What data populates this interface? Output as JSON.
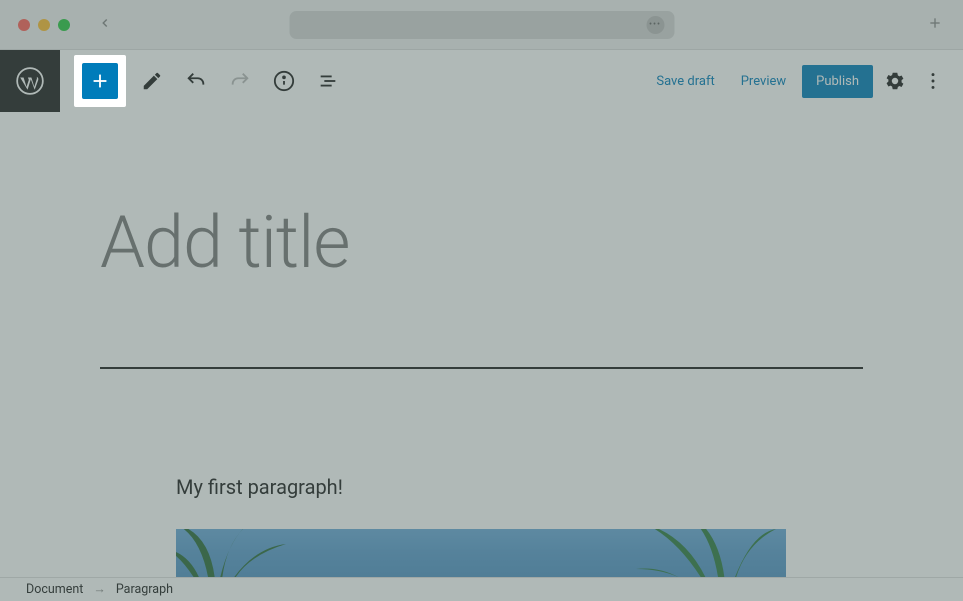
{
  "header": {
    "save_draft": "Save draft",
    "preview": "Preview",
    "publish": "Publish"
  },
  "editor": {
    "title_placeholder": "Add title",
    "paragraph": "My first paragraph!"
  },
  "breadcrumb": {
    "root": "Document",
    "current": "Paragraph"
  },
  "icons": {
    "add": "plus-icon",
    "edit": "pencil-icon",
    "undo": "undo-icon",
    "redo": "redo-icon",
    "info": "info-icon",
    "outline": "outline-icon",
    "settings": "gear-icon",
    "more": "kebab-icon",
    "wp": "wordpress-logo",
    "back": "chevron-left",
    "newtab": "plus-icon"
  }
}
